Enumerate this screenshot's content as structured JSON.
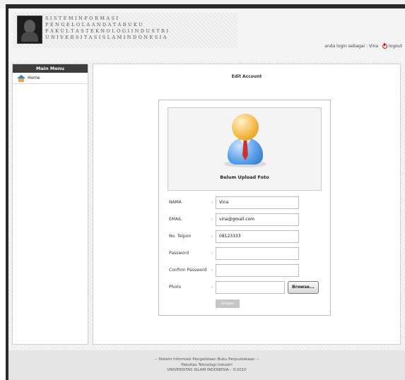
{
  "header": {
    "banner_lines": [
      "S I S T E M I N F O R M A S I",
      "P E N G E L O L A A N D A T A B U K U",
      "F A K U L T A S T E K N O L O G I I N D U S T R I",
      "U N I V E R S I T A S I S L A M I N D O N E S I A"
    ],
    "logged_in_text": "anda login sebagai : Vina",
    "logout_label": "logout"
  },
  "sidebar": {
    "title": "Main Menu",
    "items": [
      {
        "label": "Home",
        "icon": "home-icon"
      }
    ]
  },
  "main": {
    "title": "Edit Account",
    "photo_caption": "Belum Upload Foto",
    "fields": [
      {
        "label": "NAMA",
        "sep": ":",
        "value": "Vina"
      },
      {
        "label": "EMAIL",
        "sep": ":",
        "value": "vina@gmail.com"
      },
      {
        "label": "No. Telpon",
        "sep": ":",
        "value": "08123333"
      },
      {
        "label": "Password",
        "sep": ":",
        "value": ""
      },
      {
        "label": "Confirm Password",
        "sep": ":",
        "value": ""
      },
      {
        "label": "Photo",
        "sep": ":",
        "value": ""
      }
    ],
    "browse_label": "Browse...",
    "submit_label": "simpan"
  },
  "footer": {
    "lines": [
      "-- Sistem Informasi Pengelolaan Buku Perpustakaan --",
      "Fakultas Teknologi Industri",
      "UNIVERSITAS ISLAM INDONESIA - ©2010"
    ]
  }
}
